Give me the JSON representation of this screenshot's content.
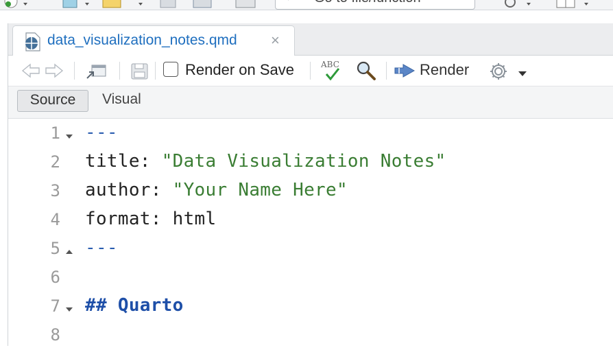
{
  "top_toolbar": {
    "goto_placeholder": "Go to file/function"
  },
  "tab": {
    "title": "data_visualization_notes.qmd",
    "close_glyph": "×"
  },
  "editor_toolbar": {
    "render_on_save_label": "Render on Save",
    "render_on_save_checked": false,
    "spellcheck_glyph": "ABC",
    "render_label": "Render"
  },
  "mode_bar": {
    "source_label": "Source",
    "visual_label": "Visual",
    "active": "Source"
  },
  "code_lines": [
    {
      "number": "1",
      "fold": "down",
      "parts": [
        {
          "t": "---",
          "c": "dash"
        }
      ]
    },
    {
      "number": "2",
      "fold": "",
      "parts": [
        {
          "t": "title: ",
          "c": "kw"
        },
        {
          "t": "\"Data Visualization Notes\"",
          "c": "str"
        }
      ]
    },
    {
      "number": "3",
      "fold": "",
      "parts": [
        {
          "t": "author: ",
          "c": "kw"
        },
        {
          "t": "\"Your Name Here\"",
          "c": "str"
        }
      ]
    },
    {
      "number": "4",
      "fold": "",
      "parts": [
        {
          "t": "format: html",
          "c": "kw"
        }
      ]
    },
    {
      "number": "5",
      "fold": "up",
      "parts": [
        {
          "t": "---",
          "c": "dash"
        }
      ]
    },
    {
      "number": "6",
      "fold": "",
      "parts": []
    },
    {
      "number": "7",
      "fold": "down",
      "parts": [
        {
          "t": "## Quarto",
          "c": "head"
        }
      ]
    },
    {
      "number": "8",
      "fold": "",
      "parts": []
    }
  ],
  "colors": {
    "tab_title": "#1f6fbf",
    "string": "#3a7d33",
    "yaml_dash": "#2a5db0",
    "heading": "#1e4fa8",
    "line_number": "#9a9a9a"
  }
}
